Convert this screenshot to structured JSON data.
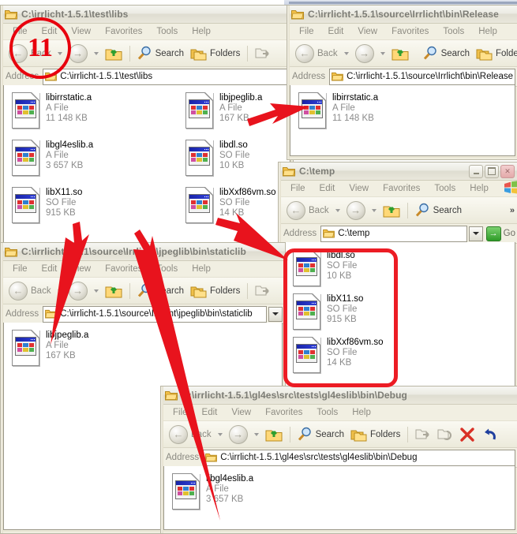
{
  "annotation": {
    "step_badge": "11",
    "accent_color": "#e8000d",
    "highlight_color": "#ec1c24"
  },
  "common": {
    "menu": [
      "File",
      "Edit",
      "View",
      "Favorites",
      "Tools",
      "Help"
    ],
    "toolbar": {
      "back": "Back",
      "search": "Search",
      "folders": "Folders"
    },
    "address_label": "Address",
    "go_label": "Go",
    "go_glyph": "→",
    "back_glyph": "←",
    "forward_glyph": "→",
    "chevron_glyph": "»"
  },
  "windows": [
    {
      "id": "libs",
      "title": "C:\\irrlicht-1.5.1\\test\\libs",
      "address": "C:\\irrlicht-1.5.1\\test\\libs",
      "files": [
        {
          "name": "libirrstatic.a",
          "type": "A File",
          "size": "11 148 KB"
        },
        {
          "name": "libgl4eslib.a",
          "type": "A File",
          "size": "3 657 KB"
        },
        {
          "name": "libX11.so",
          "type": "SO File",
          "size": "915 KB"
        },
        {
          "name": "libjpeglib.a",
          "type": "A File",
          "size": "167 KB"
        },
        {
          "name": "libdl.so",
          "type": "SO File",
          "size": "10 KB"
        },
        {
          "name": "libXxf86vm.so",
          "type": "SO File",
          "size": "14 KB"
        }
      ]
    },
    {
      "id": "release",
      "title": "C:\\irrlicht-1.5.1\\source\\Irrlicht\\bin\\Release",
      "address": "C:\\irrlicht-1.5.1\\source\\Irrlicht\\bin\\Release",
      "files": [
        {
          "name": "libirrstatic.a",
          "type": "A File",
          "size": "11 148 KB"
        }
      ]
    },
    {
      "id": "temp",
      "title": "C:\\temp",
      "address": "C:\\temp",
      "files": [
        {
          "name": "libdl.so",
          "type": "SO File",
          "size": "10 KB"
        },
        {
          "name": "libX11.so",
          "type": "SO File",
          "size": "915 KB"
        },
        {
          "name": "libXxf86vm.so",
          "type": "SO File",
          "size": "14 KB"
        }
      ]
    },
    {
      "id": "staticlib",
      "title": "C:\\irrlicht-1.5.1\\source\\Irrlicht\\jpeglib\\bin\\staticlib",
      "address": "C:\\irrlicht-1.5.1\\source\\Irrlicht\\jpeglib\\bin\\staticlib",
      "files": [
        {
          "name": "libjpeglib.a",
          "type": "A File",
          "size": "167 KB"
        }
      ]
    },
    {
      "id": "debug",
      "title": "C:\\irrlicht-1.5.1\\gl4es\\src\\tests\\gl4eslib\\bin\\Debug",
      "address": "C:\\irrlicht-1.5.1\\gl4es\\src\\tests\\gl4eslib\\bin\\Debug",
      "files": [
        {
          "name": "libgl4eslib.a",
          "type": "A File",
          "size": "3 657 KB"
        }
      ]
    }
  ]
}
